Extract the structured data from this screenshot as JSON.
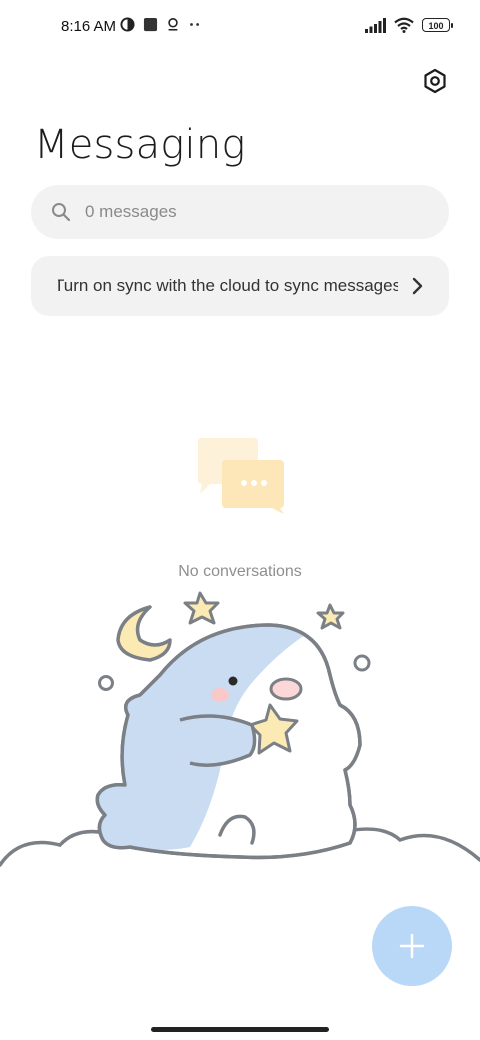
{
  "status_bar": {
    "time": "8:16 AM",
    "battery": "100",
    "left_icons": [
      "theme-icon",
      "stop-square-icon",
      "location-pin-icon",
      "more-dots-icon"
    ],
    "right_icons": [
      "signal-icon",
      "wifi-icon",
      "battery-icon"
    ]
  },
  "header": {
    "title": "Messaging",
    "settings_icon": "settings-hex-icon"
  },
  "search": {
    "placeholder": "0 messages",
    "icon": "search-icon"
  },
  "sync_banner": {
    "text": "Turn on sync with the cloud to sync messages",
    "icon": "chevron-right-icon"
  },
  "empty_state": {
    "icon": "chat-bubbles-icon",
    "text": "No conversations"
  },
  "fab": {
    "icon": "plus-icon"
  },
  "colors": {
    "background": "#ffffff",
    "surface": "#f2f2f2",
    "fab": "#b9d7f6",
    "bubble": "#fde9c0",
    "shark": "#c9dcf2",
    "star": "#fbeab4"
  }
}
